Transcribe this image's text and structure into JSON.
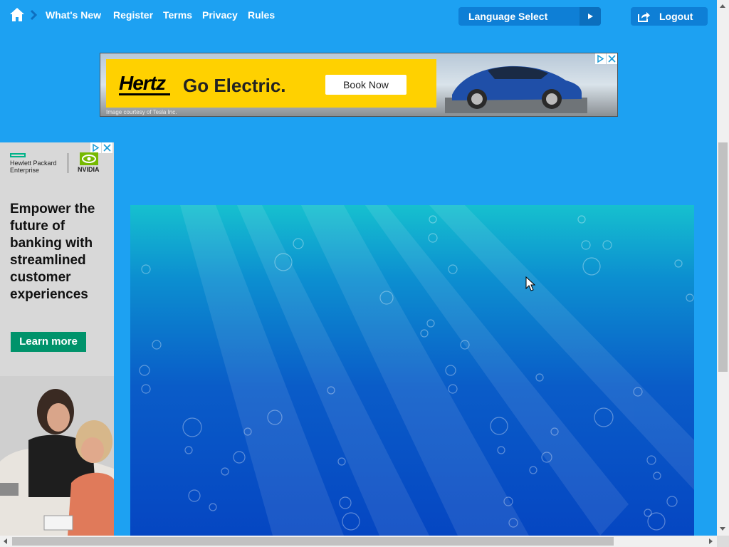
{
  "nav": {
    "links": [
      "What's New",
      "Register",
      "Terms",
      "Privacy",
      "Rules"
    ],
    "language_label": "Language Select",
    "logout_label": "Logout"
  },
  "banner_ad": {
    "brand": "Hertz",
    "headline": "Go Electric.",
    "cta": "Book Now",
    "credit": "Image courtesy of Tesla Inc."
  },
  "side_ad": {
    "brand_left": "Hewlett Packard Enterprise",
    "brand_right": "NVIDIA",
    "headline": "Empower the future of banking with streamlined customer experiences",
    "cta": "Learn more"
  },
  "colors": {
    "page_bg": "#1da1f2",
    "button_bg": "#0e7fd6",
    "hertz_yellow": "#ffd100",
    "hpe_green": "#00936b"
  },
  "icons": [
    "home-icon",
    "chevron-right-icon",
    "play-arrow-icon",
    "share-arrow-icon",
    "ad-choices-icon",
    "close-icon",
    "nvidia-eye-icon",
    "mouse-cursor-icon"
  ]
}
